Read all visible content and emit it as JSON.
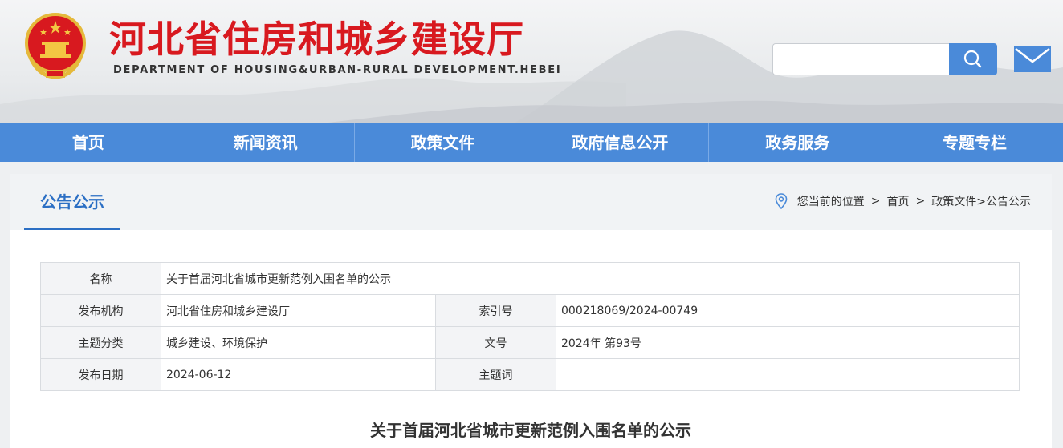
{
  "header": {
    "title": "河北省住房和城乡建设厅",
    "subtitle": "DEPARTMENT OF HOUSING&URBAN-RURAL DEVELOPMENT.HEBEI",
    "search": {
      "value": "",
      "icon": "search-icon"
    },
    "mail_icon": "mail-icon"
  },
  "nav": [
    "首页",
    "新闻资讯",
    "政策文件",
    "政府信息公开",
    "政务服务",
    "专题专栏"
  ],
  "panel": {
    "title": "公告公示",
    "breadcrumb": {
      "prefix": "您当前的位置",
      "sep": ">",
      "home": "首页",
      "path": "政策文件>公告公示"
    }
  },
  "meta": {
    "name_label": "名称",
    "name_value": "关于首届河北省城市更新范例入围名单的公示",
    "publisher_label": "发布机构",
    "publisher_value": "河北省住房和城乡建设厅",
    "index_label": "索引号",
    "index_value": "000218069/2024-00749",
    "category_label": "主题分类",
    "category_value": "城乡建设、环境保护",
    "docno_label": "文号",
    "docno_value": "2024年 第93号",
    "date_label": "发布日期",
    "date_value": "2024-06-12",
    "keyword_label": "主题词",
    "keyword_value": ""
  },
  "document": {
    "title": "关于首届河北省城市更新范例入围名单的公示"
  },
  "colors": {
    "brand_red": "#d8191f",
    "nav_blue": "#4a8ad9",
    "title_blue": "#2c6fc4"
  }
}
